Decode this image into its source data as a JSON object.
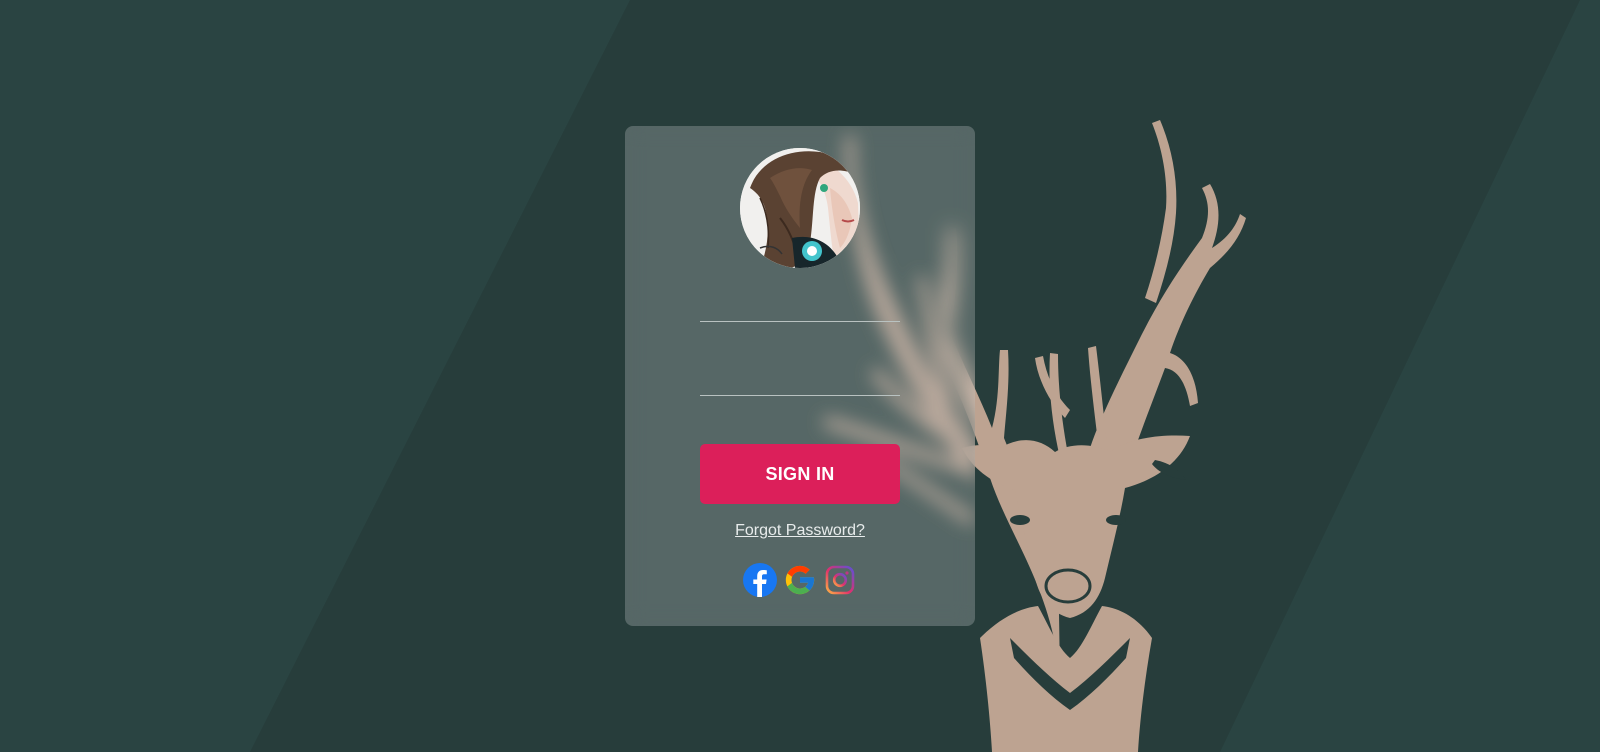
{
  "login_form": {
    "username_placeholder": "",
    "password_placeholder": "",
    "signin_label": "SIGN IN",
    "forgot_label": "Forgot Password?"
  },
  "social_buttons": [
    {
      "icon": "facebook-icon",
      "color": "#1877f2"
    },
    {
      "icon": "google-icon",
      "color": "#4285f4"
    },
    {
      "icon": "instagram-icon",
      "color": "#c13584"
    }
  ],
  "colors": {
    "background": "#273d3b",
    "background_band": "#2b4543",
    "card": "rgba(255,255,255,0.22)",
    "accent": "#dc1f5a",
    "deer": "#bda391"
  }
}
